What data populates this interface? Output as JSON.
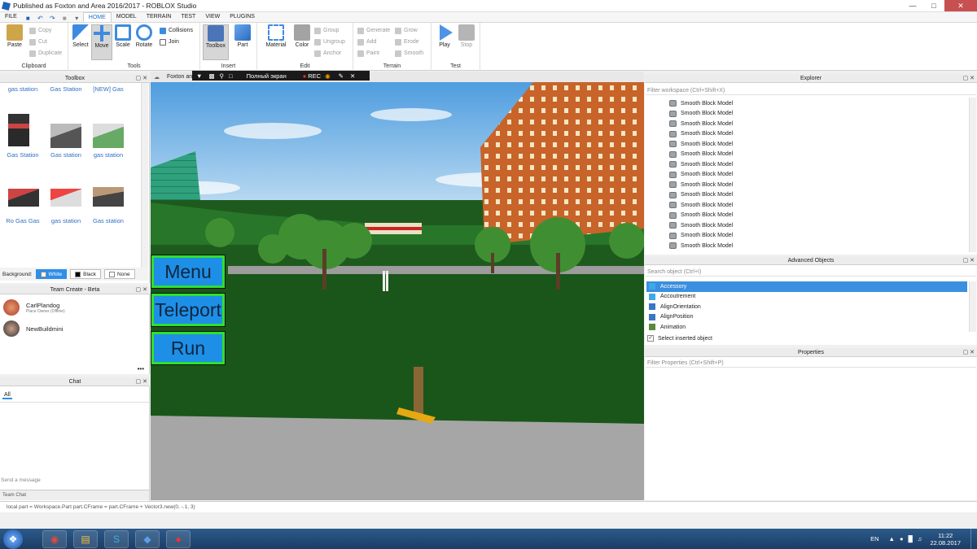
{
  "window": {
    "title": "Published as Foxton and Area 2016/2017 - ROBLOX Studio"
  },
  "menu": {
    "file": "FILE",
    "tabs": [
      "HOME",
      "MODEL",
      "TERRAIN",
      "TEST",
      "VIEW",
      "PLUGINS"
    ]
  },
  "ribbon": {
    "clipboard": {
      "label": "Clipboard",
      "paste": "Paste",
      "copy": "Copy",
      "cut": "Cut",
      "duplicate": "Duplicate"
    },
    "tools": {
      "label": "Tools",
      "select": "Select",
      "move": "Move",
      "scale": "Scale",
      "rotate": "Rotate",
      "collisions": "Collisions",
      "join": "Join"
    },
    "insert": {
      "label": "Insert",
      "toolbox": "Toolbox",
      "part": "Part"
    },
    "edit": {
      "label": "Edit",
      "material": "Material",
      "color": "Color",
      "group": "Group",
      "ungroup": "Ungroup",
      "anchor": "Anchor"
    },
    "terrain": {
      "label": "Terrain",
      "generate": "Generate",
      "add": "Add",
      "paint": "Paint",
      "grow": "Grow",
      "erode": "Erode",
      "smooth": "Smooth"
    },
    "test": {
      "label": "Test",
      "play": "Play",
      "stop": "Stop"
    }
  },
  "toolbox": {
    "title": "Toolbox",
    "items": [
      "gas station",
      "Gas Station",
      "[NEW] Gas",
      "Gas Station",
      "Gas station",
      "gas station",
      "Ro Gas Gas",
      "gas station",
      "Gas station"
    ],
    "background_label": "Background:",
    "bg_options": [
      "White",
      "Black",
      "None"
    ]
  },
  "team_create": {
    "title": "Team Create - Beta",
    "members": [
      {
        "name": "CarlPlandog",
        "role": "Place Owner (Offline)"
      },
      {
        "name": "NewBuildmini",
        "role": ""
      }
    ],
    "more": "•••"
  },
  "chat": {
    "title": "Chat",
    "tab": "All",
    "placeholder": "Send a message",
    "footer": "Team Chat"
  },
  "viewport": {
    "tab": "Foxton an",
    "rec_label": "Полный экран",
    "rec": "REC",
    "buttons": {
      "menu": "Menu",
      "teleport": "Teleport",
      "run": "Run"
    }
  },
  "explorer": {
    "title": "Explorer",
    "filter": "Filter workspace (Ctrl+Shift+X)",
    "items": [
      "Smooth Block Model",
      "Smooth Block Model",
      "Smooth Block Model",
      "Smooth Block Model",
      "Smooth Block Model",
      "Smooth Block Model",
      "Smooth Block Model",
      "Smooth Block Model",
      "Smooth Block Model",
      "Smooth Block Model",
      "Smooth Block Model",
      "Smooth Block Model",
      "Smooth Block Model",
      "Smooth Block Model",
      "Smooth Block Model"
    ]
  },
  "advanced": {
    "title": "Advanced Objects",
    "search": "Search object (Ctrl+I)",
    "items": [
      "Accessory",
      "Accoutrement",
      "AlignOrientation",
      "AlignPosition",
      "Animation"
    ],
    "select_inserted": "Select inserted object"
  },
  "properties": {
    "title": "Properties",
    "filter": "Filter Properties (Ctrl+Shift+P)"
  },
  "command_bar": "local part = Workspace.Part part.CFrame = part.CFrame + Vector3.new(0, -.1, 3)",
  "taskbar": {
    "lang": "EN",
    "time": "11:22",
    "date": "22.08.2017"
  }
}
